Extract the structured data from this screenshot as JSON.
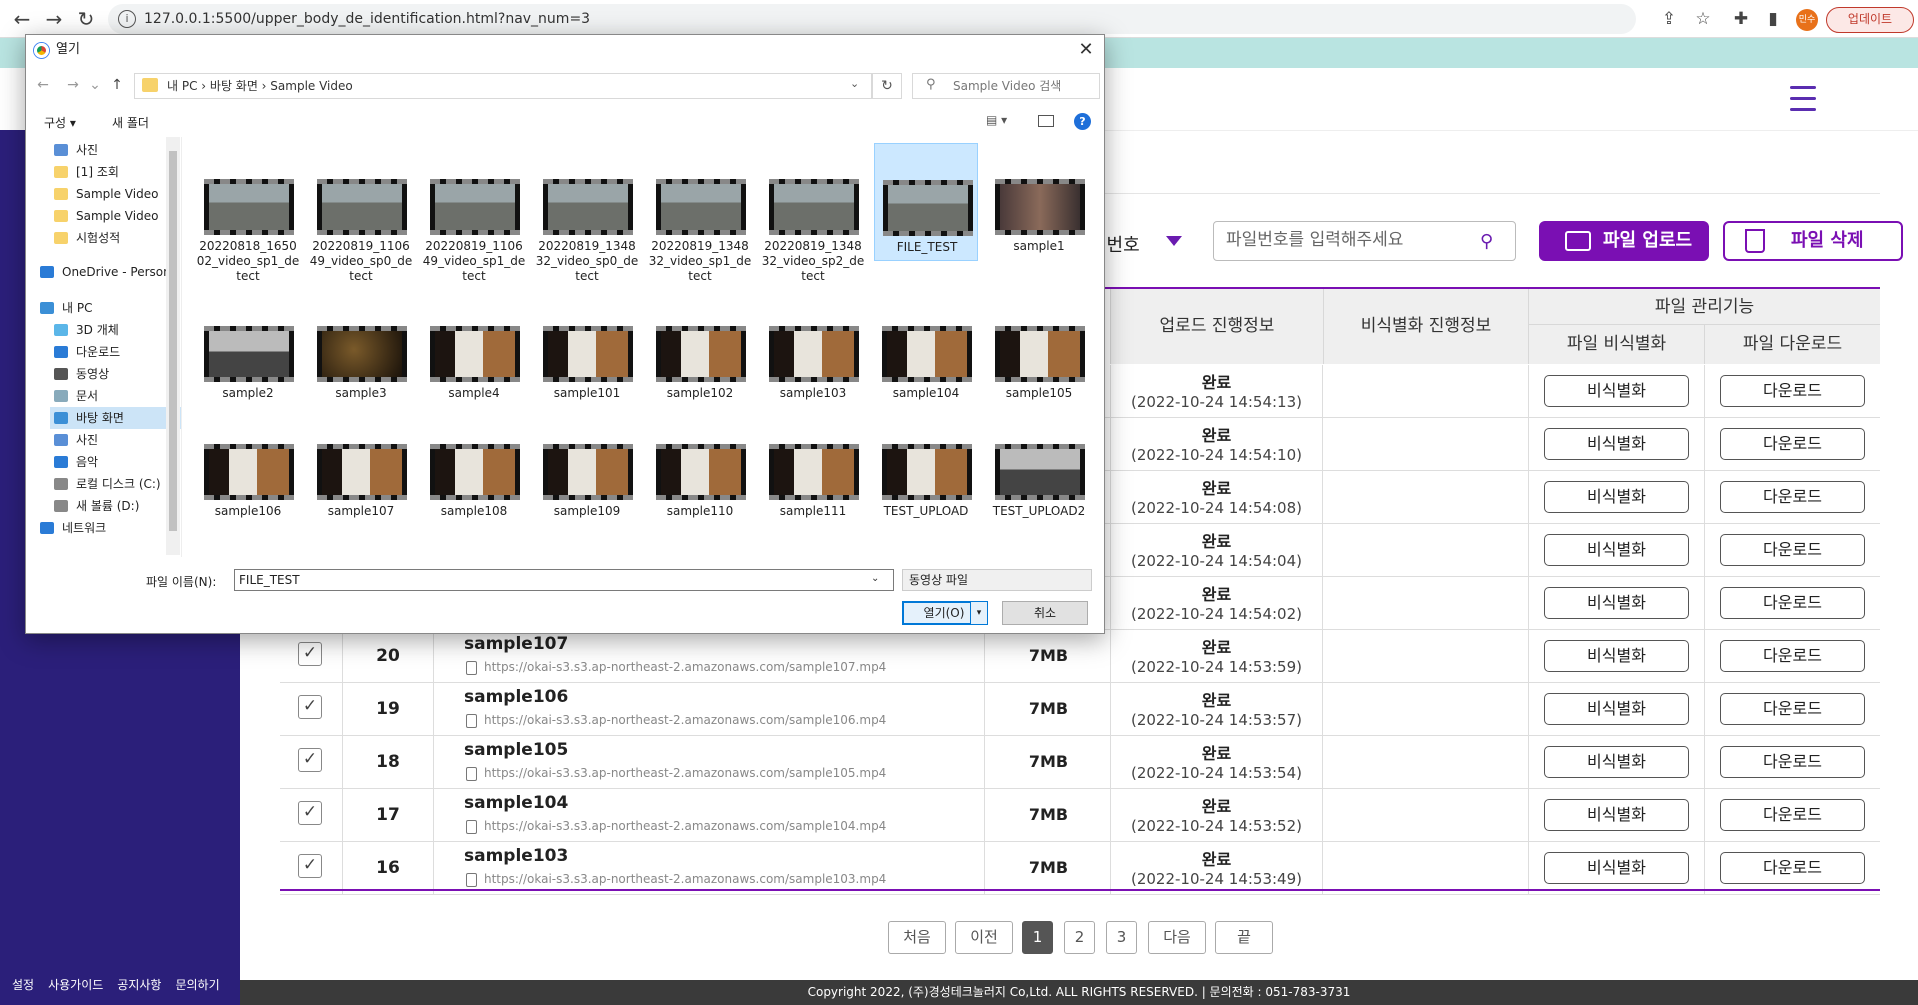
{
  "browser": {
    "url": "127.0.0.1:5500/upper_body_de_identification.html?nav_num=3",
    "profile_initial": "민수",
    "update_label": "업데이트"
  },
  "sidebar": {
    "footer_links": [
      "설정",
      "사용가이드",
      "공지사항",
      "문의하기"
    ]
  },
  "search": {
    "label": "일번호",
    "placeholder": "파일번호를 입력해주세요"
  },
  "actions": {
    "upload_label": "파일 업로드",
    "delete_label": "파일 삭제"
  },
  "table": {
    "headers": {
      "upload_info": "업로드 진행정보",
      "deid_info": "비식별화 진행정보",
      "manage": "파일 관리기능",
      "deid": "파일 비식별화",
      "download": "파일 다운로드"
    },
    "button_deid": "비식별화",
    "button_download": "다운로드",
    "hidden_rows": [
      {
        "status": "완료",
        "time": "(2022-10-24 14:54:13)"
      },
      {
        "status": "완료",
        "time": "(2022-10-24 14:54:10)"
      },
      {
        "status": "완료",
        "time": "(2022-10-24 14:54:08)"
      },
      {
        "status": "완료",
        "time": "(2022-10-24 14:54:04)"
      },
      {
        "status": "완료",
        "time": "(2022-10-24 14:54:02)"
      }
    ],
    "rows": [
      {
        "num": "20",
        "name": "sample107",
        "url": "https://okai-s3.s3.ap-northeast-2.amazonaws.com/sample107.mp4",
        "size": "7MB",
        "status": "완료",
        "time": "(2022-10-24 14:53:59)"
      },
      {
        "num": "19",
        "name": "sample106",
        "url": "https://okai-s3.s3.ap-northeast-2.amazonaws.com/sample106.mp4",
        "size": "7MB",
        "status": "완료",
        "time": "(2022-10-24 14:53:57)"
      },
      {
        "num": "18",
        "name": "sample105",
        "url": "https://okai-s3.s3.ap-northeast-2.amazonaws.com/sample105.mp4",
        "size": "7MB",
        "status": "완료",
        "time": "(2022-10-24 14:53:54)"
      },
      {
        "num": "17",
        "name": "sample104",
        "url": "https://okai-s3.s3.ap-northeast-2.amazonaws.com/sample104.mp4",
        "size": "7MB",
        "status": "완료",
        "time": "(2022-10-24 14:53:52)"
      },
      {
        "num": "16",
        "name": "sample103",
        "url": "https://okai-s3.s3.ap-northeast-2.amazonaws.com/sample103.mp4",
        "size": "7MB",
        "status": "완료",
        "time": "(2022-10-24 14:53:49)"
      }
    ]
  },
  "pagination": {
    "first": "처음",
    "prev": "이전",
    "pages": [
      "1",
      "2",
      "3"
    ],
    "current": "1",
    "next": "다음",
    "last": "끝"
  },
  "footer": {
    "text": "Copyright 2022, (주)경성테크놀러지 Co,Ltd. ALL RIGHTS RESERVED.  |  문의전화 : 051-783-3731"
  },
  "dialog": {
    "title": "열기",
    "breadcrumb": "내 PC  ›  바탕 화면  ›  Sample Video",
    "search_placeholder": "Sample Video 검색",
    "organize": "구성 ▾",
    "new_folder": "새 폴더",
    "nav_items": [
      {
        "label": "사진",
        "color": "#5a8fd6"
      },
      {
        "label": "[1] 조회",
        "color": "#f7d26b"
      },
      {
        "label": "Sample Video",
        "color": "#f7d26b"
      },
      {
        "label": "Sample Video",
        "color": "#f7d26b"
      },
      {
        "label": "시험성적",
        "color": "#f7d26b"
      },
      {
        "label": "OneDrive - Person",
        "color": "#2a7bd6"
      },
      {
        "label": "내 PC",
        "color": "#3b8fd6"
      },
      {
        "label": "3D 개체",
        "color": "#5bb6e8"
      },
      {
        "label": "다운로드",
        "color": "#2a7bd6"
      },
      {
        "label": "동영상",
        "color": "#555"
      },
      {
        "label": "문서",
        "color": "#8ab"
      },
      {
        "label": "바탕 화면",
        "color": "#3b8fd6"
      },
      {
        "label": "사진",
        "color": "#5a8fd6"
      },
      {
        "label": "음악",
        "color": "#2a7bd6"
      },
      {
        "label": "로컬 디스크 (C:)",
        "color": "#888"
      },
      {
        "label": "새 볼륨 (D:)",
        "color": "#888"
      },
      {
        "label": "네트워크",
        "color": "#2a7bd6"
      }
    ],
    "files": [
      {
        "name": "20220818_165002_video_sp1_detect",
        "tone": "road"
      },
      {
        "name": "20220819_110649_video_sp0_detect",
        "tone": "road"
      },
      {
        "name": "20220819_110649_video_sp1_detect",
        "tone": "road"
      },
      {
        "name": "20220819_134832_video_sp0_detect",
        "tone": "road"
      },
      {
        "name": "20220819_134832_video_sp1_detect",
        "tone": "road"
      },
      {
        "name": "20220819_134832_video_sp2_detect",
        "tone": "road"
      },
      {
        "name": "FILE_TEST",
        "tone": "road"
      },
      {
        "name": "sample1",
        "tone": "street"
      },
      {
        "name": "sample2",
        "tone": "gray"
      },
      {
        "name": "sample3",
        "tone": "dark"
      },
      {
        "name": "sample4",
        "tone": "room"
      },
      {
        "name": "sample101",
        "tone": "room"
      },
      {
        "name": "sample102",
        "tone": "room"
      },
      {
        "name": "sample103",
        "tone": "room"
      },
      {
        "name": "sample104",
        "tone": "room"
      },
      {
        "name": "sample105",
        "tone": "room"
      },
      {
        "name": "sample106",
        "tone": "room"
      },
      {
        "name": "sample107",
        "tone": "room"
      },
      {
        "name": "sample108",
        "tone": "room"
      },
      {
        "name": "sample109",
        "tone": "room"
      },
      {
        "name": "sample110",
        "tone": "room"
      },
      {
        "name": "sample111",
        "tone": "room"
      },
      {
        "name": "TEST_UPLOAD",
        "tone": "room"
      },
      {
        "name": "TEST_UPLOAD2",
        "tone": "gray"
      }
    ],
    "selected_file": "FILE_TEST",
    "filename_label": "파일 이름(N):",
    "filename_value": "FILE_TEST",
    "filetype": "동영상 파일",
    "open_label": "열기(O)",
    "cancel_label": "취소"
  }
}
